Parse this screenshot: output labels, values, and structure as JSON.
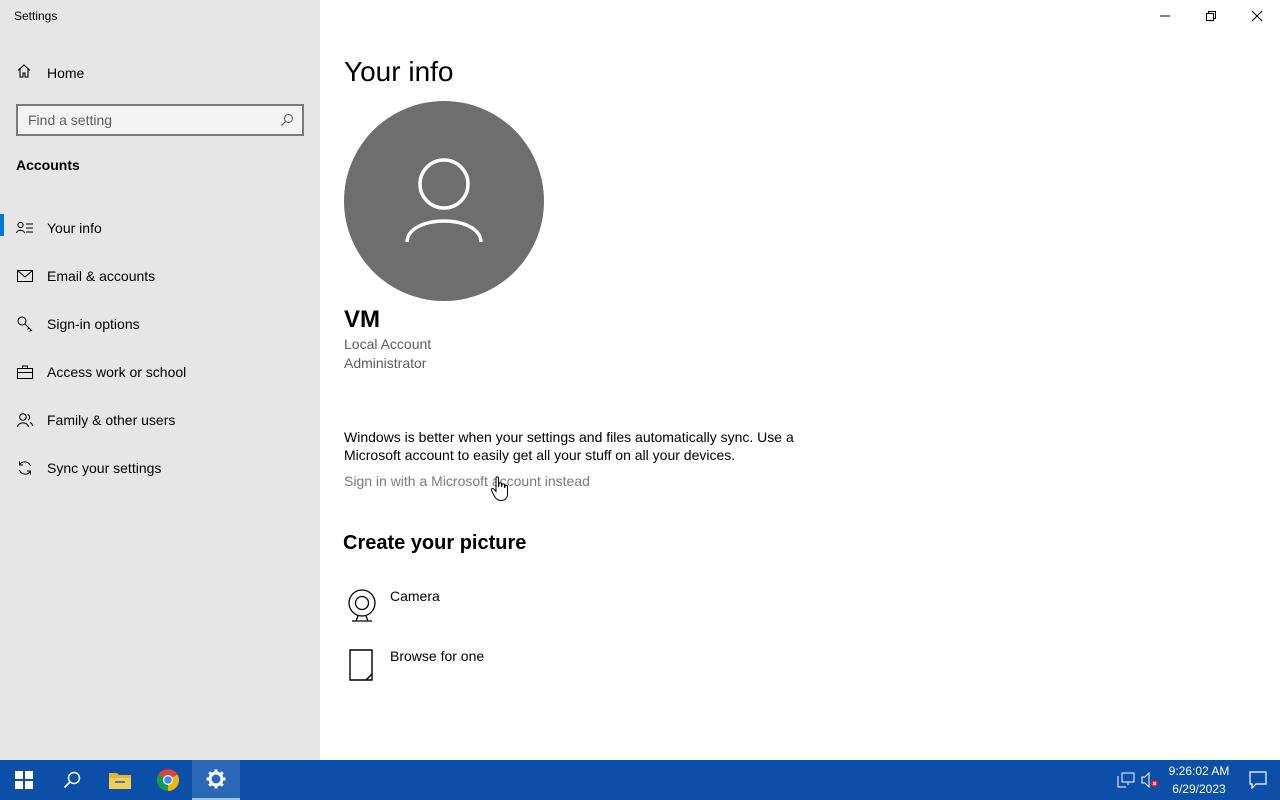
{
  "window": {
    "title": "Settings",
    "controls": [
      "minimize",
      "restore",
      "close"
    ]
  },
  "sidebar": {
    "home_label": "Home",
    "search_placeholder": "Find a setting",
    "section_title": "Accounts",
    "items": [
      {
        "label": "Your info",
        "icon": "person-list-icon",
        "active": true
      },
      {
        "label": "Email & accounts",
        "icon": "mail-icon"
      },
      {
        "label": "Sign-in options",
        "icon": "key-icon"
      },
      {
        "label": "Access work or school",
        "icon": "briefcase-icon"
      },
      {
        "label": "Family & other users",
        "icon": "people-icon"
      },
      {
        "label": "Sync your settings",
        "icon": "sync-icon"
      }
    ]
  },
  "main": {
    "title": "Your info",
    "user": {
      "name": "VM",
      "account_type": "Local Account",
      "role": "Administrator"
    },
    "sync_message": "Windows is better when your settings and files automatically sync. Use a Microsoft account to easily get all your stuff on all your devices.",
    "signin_link": "Sign in with a Microsoft account instead",
    "picture_heading": "Create your picture",
    "picture_options": [
      {
        "label": "Camera",
        "icon": "webcam-icon"
      },
      {
        "label": "Browse for one",
        "icon": "document-icon"
      }
    ]
  },
  "taskbar": {
    "time": "9:26:02 AM",
    "date": "6/29/2023",
    "colors": {
      "background": "#0b4fa8",
      "accent": "#0078d7"
    }
  }
}
